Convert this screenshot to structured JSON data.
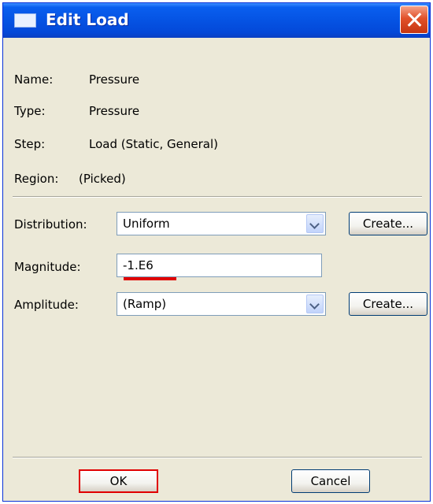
{
  "window": {
    "title": "Edit Load",
    "close_icon": "close-icon"
  },
  "info": {
    "name_label": "Name:",
    "name_value": "Pressure",
    "type_label": "Type:",
    "type_value": "Pressure",
    "step_label": "Step:",
    "step_value": "Load (Static, General)",
    "region_label": "Region:",
    "region_value": "(Picked)"
  },
  "form": {
    "distribution_label": "Distribution:",
    "distribution_value": "Uniform",
    "distribution_create_label": "Create...",
    "magnitude_label": "Magnitude:",
    "magnitude_value": "-1.E6",
    "amplitude_label": "Amplitude:",
    "amplitude_value": "(Ramp)",
    "amplitude_create_label": "Create..."
  },
  "buttons": {
    "ok_label": "OK",
    "cancel_label": "Cancel"
  },
  "colors": {
    "highlight": "#e00000",
    "titlebar": "#0553e3"
  }
}
